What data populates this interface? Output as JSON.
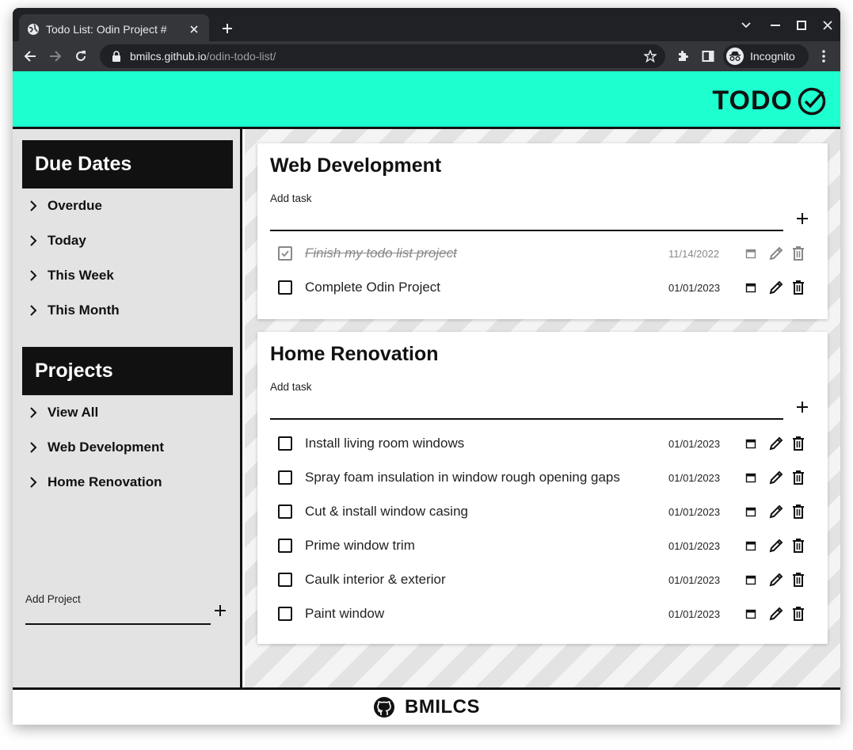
{
  "browser": {
    "tab_title": "Todo List: Odin Project #",
    "url_host": "bmilcs.github.io",
    "url_path": "/odin-todo-list/",
    "incognito_label": "Incognito"
  },
  "header": {
    "brand": "TODO"
  },
  "sidebar": {
    "due_heading": "Due Dates",
    "due_items": [
      {
        "label": "Overdue"
      },
      {
        "label": "Today"
      },
      {
        "label": "This Week"
      },
      {
        "label": "This Month"
      }
    ],
    "projects_heading": "Projects",
    "project_items": [
      {
        "label": "View All"
      },
      {
        "label": "Web Development"
      },
      {
        "label": "Home Renovation"
      }
    ],
    "add_project_label": "Add Project"
  },
  "projects": [
    {
      "title": "Web Development",
      "add_task_label": "Add task",
      "tasks": [
        {
          "name": "Finish my todo list project",
          "date": "11/14/2022",
          "done": true
        },
        {
          "name": "Complete Odin Project",
          "date": "01/01/2023",
          "done": false
        }
      ]
    },
    {
      "title": "Home Renovation",
      "add_task_label": "Add task",
      "tasks": [
        {
          "name": "Install living room windows",
          "date": "01/01/2023",
          "done": false
        },
        {
          "name": "Spray foam insulation in window rough opening gaps",
          "date": "01/01/2023",
          "done": false
        },
        {
          "name": "Cut & install window casing",
          "date": "01/01/2023",
          "done": false
        },
        {
          "name": "Prime window trim",
          "date": "01/01/2023",
          "done": false
        },
        {
          "name": "Caulk interior & exterior",
          "date": "01/01/2023",
          "done": false
        },
        {
          "name": "Paint window",
          "date": "01/01/2023",
          "done": false
        }
      ]
    }
  ],
  "footer": {
    "text": "BMILCS"
  },
  "colors": {
    "accent": "#1effd0",
    "dark": "#111111",
    "sidebar_bg": "#e3e3e3"
  }
}
